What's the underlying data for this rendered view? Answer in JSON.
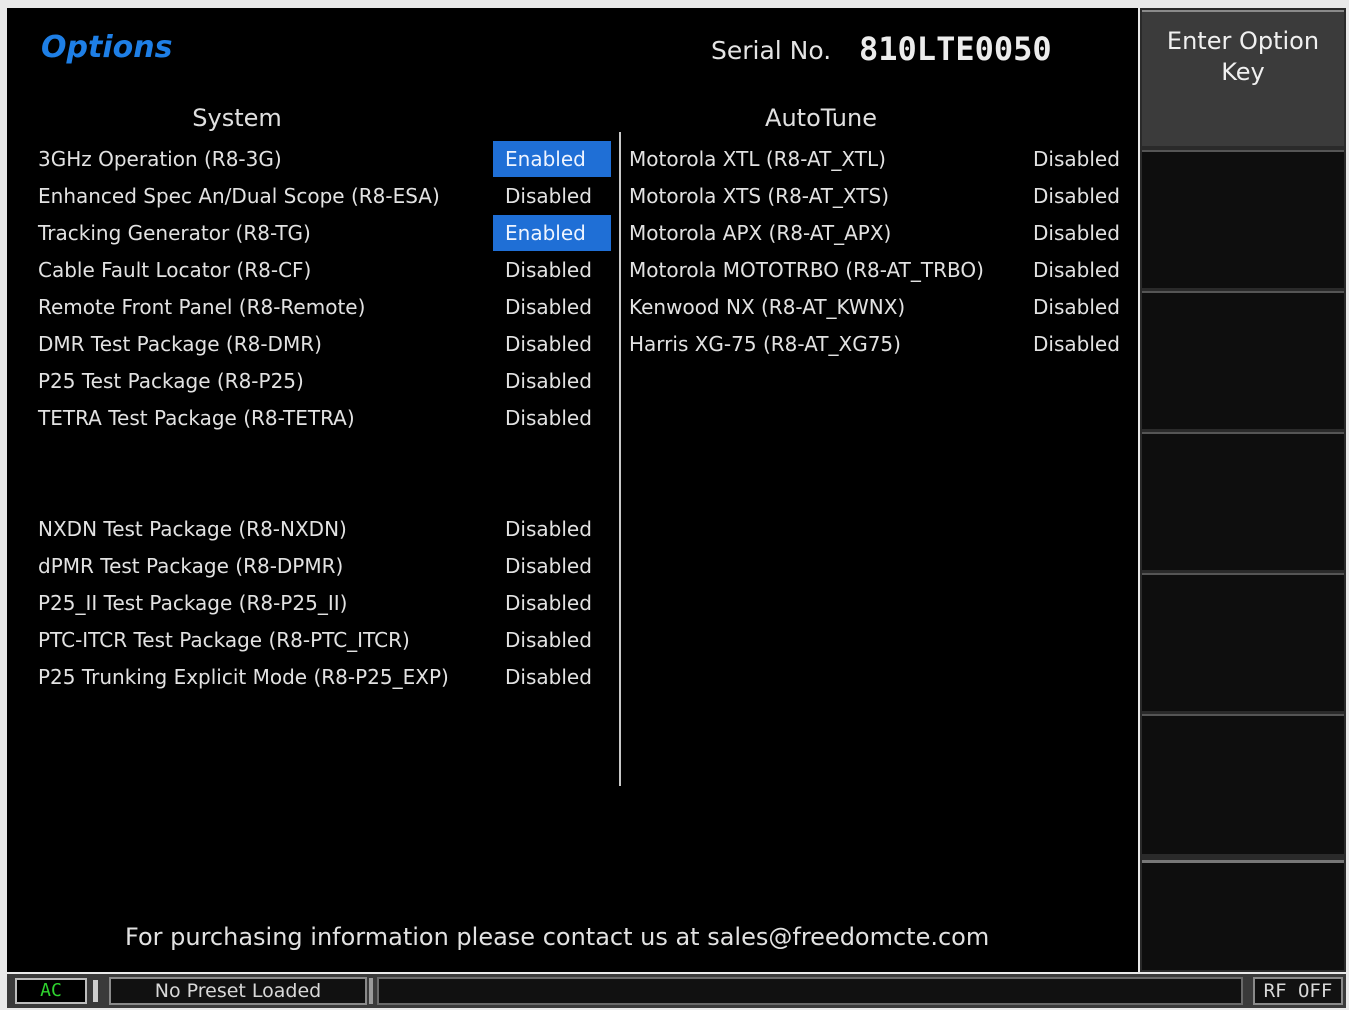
{
  "header": {
    "title": "Options",
    "serial_label": "Serial No.",
    "serial_value": "810LTE0050"
  },
  "system": {
    "heading": "System",
    "options": [
      {
        "name": "3GHz Operation (R8-3G)",
        "status": "Enabled"
      },
      {
        "name": "Enhanced Spec An/Dual Scope (R8-ESA)",
        "status": "Disabled"
      },
      {
        "name": "Tracking Generator (R8-TG)",
        "status": "Enabled"
      },
      {
        "name": "Cable Fault Locator (R8-CF)",
        "status": "Disabled"
      },
      {
        "name": "Remote Front Panel (R8-Remote)",
        "status": "Disabled"
      },
      {
        "name": "DMR Test Package (R8-DMR)",
        "status": "Disabled"
      },
      {
        "name": "P25 Test Package (R8-P25)",
        "status": "Disabled"
      },
      {
        "name": "TETRA Test Package (R8-TETRA)",
        "status": "Disabled"
      },
      {
        "name": "NXDN Test Package (R8-NXDN)",
        "status": "Disabled"
      },
      {
        "name": "dPMR Test Package (R8-DPMR)",
        "status": "Disabled"
      },
      {
        "name": "P25_II Test Package (R8-P25_II)",
        "status": "Disabled"
      },
      {
        "name": "PTC-ITCR Test Package (R8-PTC_ITCR)",
        "status": "Disabled"
      },
      {
        "name": "P25 Trunking Explicit Mode (R8-P25_EXP)",
        "status": "Disabled"
      }
    ]
  },
  "autotune": {
    "heading": "AutoTune",
    "options": [
      {
        "name": "Motorola XTL (R8-AT_XTL)",
        "status": "Disabled"
      },
      {
        "name": "Motorola XTS (R8-AT_XTS)",
        "status": "Disabled"
      },
      {
        "name": "Motorola APX (R8-AT_APX)",
        "status": "Disabled"
      },
      {
        "name": "Motorola MOTOTRBO (R8-AT_TRBO)",
        "status": "Disabled"
      },
      {
        "name": "Kenwood NX (R8-AT_KWNX)",
        "status": "Disabled"
      },
      {
        "name": "Harris XG-75 (R8-AT_XG75)",
        "status": "Disabled"
      }
    ]
  },
  "footer": {
    "purchase_text": "For purchasing information please contact us at sales@freedomcte.com"
  },
  "softkeys": {
    "enter_option_key": "Enter Option Key"
  },
  "statusbar": {
    "power": "AC",
    "preset": "No Preset Loaded",
    "rf": "RF OFF"
  },
  "colors": {
    "title": "#1e7fe6",
    "enabled_bg": "#1f6fd6",
    "screen_bg": "#000000",
    "ac_text": "#2fd32f"
  }
}
